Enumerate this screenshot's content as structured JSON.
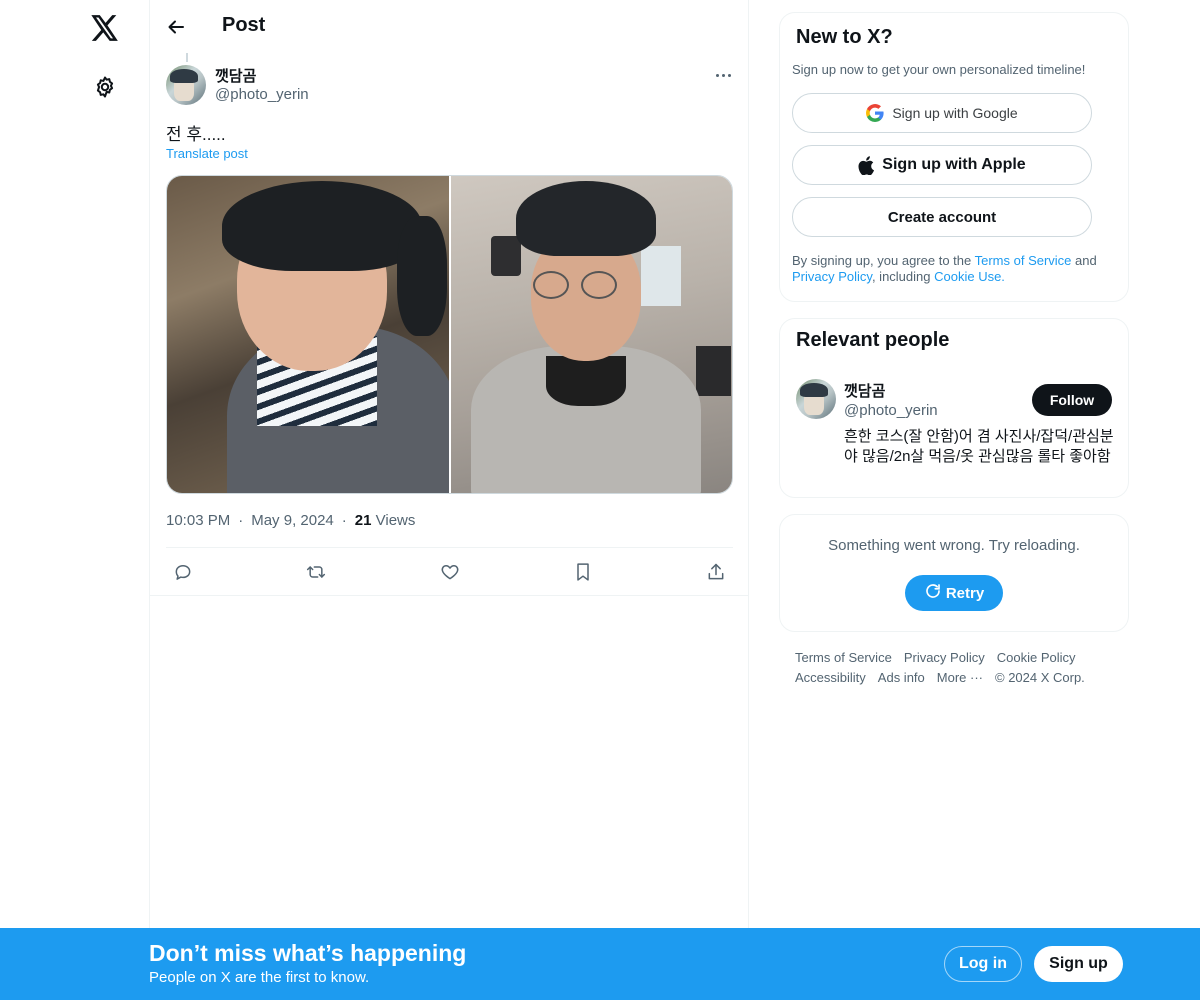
{
  "nav": {
    "logo_icon": "x-logo-icon",
    "settings_icon": "gear-icon"
  },
  "header": {
    "title": "Post",
    "back_icon": "arrow-left-icon"
  },
  "post": {
    "author_name": "깻담곰",
    "author_handle": "@photo_yerin",
    "text": "전 후.....",
    "translate_label": "Translate post",
    "time": "10:03 PM",
    "date": "May 9, 2024",
    "views_count": "21",
    "views_label": "Views",
    "separator": "·",
    "actions": [
      "reply-icon",
      "repost-icon",
      "like-icon",
      "bookmark-icon",
      "share-icon"
    ]
  },
  "signup_card": {
    "title": "New to X?",
    "subtitle": "Sign up now to get your own personalized timeline!",
    "google_label": "Sign up with Google",
    "apple_label": "Sign up with Apple",
    "create_label": "Create account",
    "terms_prefix": "By signing up, you agree to the ",
    "terms_link": "Terms of Service",
    "terms_and": " and ",
    "privacy_link": "Privacy Policy",
    "terms_including": ", including ",
    "cookie_link": "Cookie Use."
  },
  "people_card": {
    "title": "Relevant people",
    "name": "깻담곰",
    "handle": "@photo_yerin",
    "follow_label": "Follow",
    "bio": "흔한 코스(잘 안함)어 겸 사진사/잡덕/관심분야 많음/2n살 먹음/옷 관심많음 롤타 좋아함"
  },
  "error_card": {
    "message": "Something went wrong. Try reloading.",
    "retry_label": "Retry"
  },
  "footer": {
    "links": [
      "Terms of Service",
      "Privacy Policy",
      "Cookie Policy",
      "Accessibility",
      "Ads info",
      "More ···"
    ],
    "copyright": "© 2024 X Corp."
  },
  "banner": {
    "title": "Don’t miss what’s happening",
    "subtitle": "People on X are the first to know.",
    "login_label": "Log in",
    "signup_label": "Sign up"
  },
  "colors": {
    "accent": "#1d9bf0",
    "text": "#0f1419",
    "secondary": "#536471",
    "border": "#eff3f4"
  }
}
